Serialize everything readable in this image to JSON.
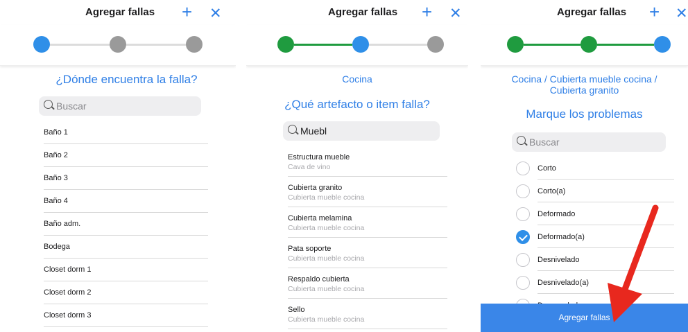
{
  "header": {
    "title": "Agregar fallas",
    "plus": "+",
    "close": "✕"
  },
  "panel1": {
    "question": "¿Dónde encuentra la falla?",
    "search_placeholder": "Buscar",
    "items": [
      "Baño 1",
      "Baño 2",
      "Baño 3",
      "Baño 4",
      "Baño adm.",
      "Bodega",
      "Closet dorm 1",
      "Closet dorm 2",
      "Closet dorm 3"
    ]
  },
  "panel2": {
    "breadcrumb": "Cocina",
    "question": "¿Qué artefacto o item falla?",
    "search_value": "Muebl",
    "items": [
      {
        "title": "Estructura mueble",
        "subtitle": "Cava de vino"
      },
      {
        "title": "Cubierta granito",
        "subtitle": "Cubierta mueble cocina"
      },
      {
        "title": "Cubierta melamina",
        "subtitle": "Cubierta mueble cocina"
      },
      {
        "title": "Pata soporte",
        "subtitle": "Cubierta mueble cocina"
      },
      {
        "title": "Respaldo cubierta",
        "subtitle": "Cubierta mueble cocina"
      },
      {
        "title": "Sello",
        "subtitle": "Cubierta mueble cocina"
      }
    ]
  },
  "panel3": {
    "breadcrumb_line1": "Cocina / Cubierta mueble cocina /",
    "breadcrumb_line2": "Cubierta granito",
    "question": "Marque los problemas",
    "search_placeholder": "Buscar",
    "items": [
      {
        "label": "Corto",
        "checked": false
      },
      {
        "label": "Corto(a)",
        "checked": false
      },
      {
        "label": "Deformado",
        "checked": false
      },
      {
        "label": "Deformado(a)",
        "checked": true
      },
      {
        "label": "Desnivelado",
        "checked": false
      },
      {
        "label": "Desnivelado(a)",
        "checked": false
      },
      {
        "label": "Desnuvelado",
        "checked": false
      }
    ],
    "submit_label": "Agregar fallas"
  },
  "colors": {
    "accent": "#2f7fe6",
    "step_done": "#1f9b3f",
    "step_active": "#2f8fe8",
    "step_pending": "#9a9a9a",
    "arrow": "#e8281e"
  }
}
